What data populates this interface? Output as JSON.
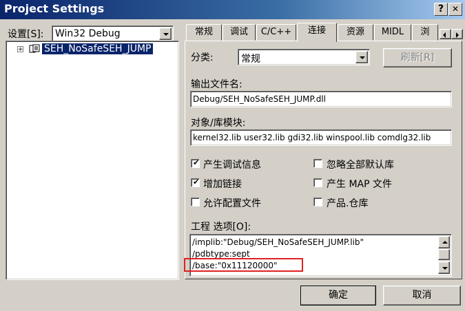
{
  "window": {
    "title": "Project Settings",
    "help_btn": "?",
    "close_btn": "✕"
  },
  "settings_for": {
    "label": "设置[S]:",
    "value": "Win32 Debug"
  },
  "tree": {
    "expander": "+",
    "project": "SEH_NoSafeSEH_JUMP"
  },
  "tabs": [
    {
      "label": "常规"
    },
    {
      "label": "调试"
    },
    {
      "label": "C/C++"
    },
    {
      "label": "连接"
    },
    {
      "label": "资源"
    },
    {
      "label": "MIDL"
    },
    {
      "label": "浏"
    }
  ],
  "active_tab": "连接",
  "category": {
    "label": "分类:",
    "value": "常规",
    "refresh_btn": "刷新[R]"
  },
  "output_file": {
    "label": "输出文件名:",
    "value": "Debug/SEH_NoSafeSEH_JUMP.dll"
  },
  "modules": {
    "label": "对象/库模块:",
    "value": "kernel32.lib user32.lib gdi32.lib winspool.lib comdlg32.lib"
  },
  "checkboxes": [
    {
      "label": "产生调试信息",
      "checked": true
    },
    {
      "label": "忽略全部默认库",
      "checked": false
    },
    {
      "label": "增加链接",
      "checked": true
    },
    {
      "label": "产生 MAP 文件",
      "checked": false
    },
    {
      "label": "允许配置文件",
      "checked": false
    },
    {
      "label": "产品.仓库",
      "checked": false
    }
  ],
  "project_options": {
    "label": "工程 选项[O]:",
    "lines": [
      "/implib:\"Debug/SEH_NoSafeSEH_JUMP.lib\"",
      "/pdbtype:sept",
      "/base:\"0x11120000\""
    ],
    "highlight_color": "#e02020"
  },
  "buttons": {
    "ok": "确定",
    "cancel": "取消"
  },
  "colors": {
    "title_blue": "#0a246a",
    "selection": "#0a246a",
    "face": "#d4d0c8"
  }
}
